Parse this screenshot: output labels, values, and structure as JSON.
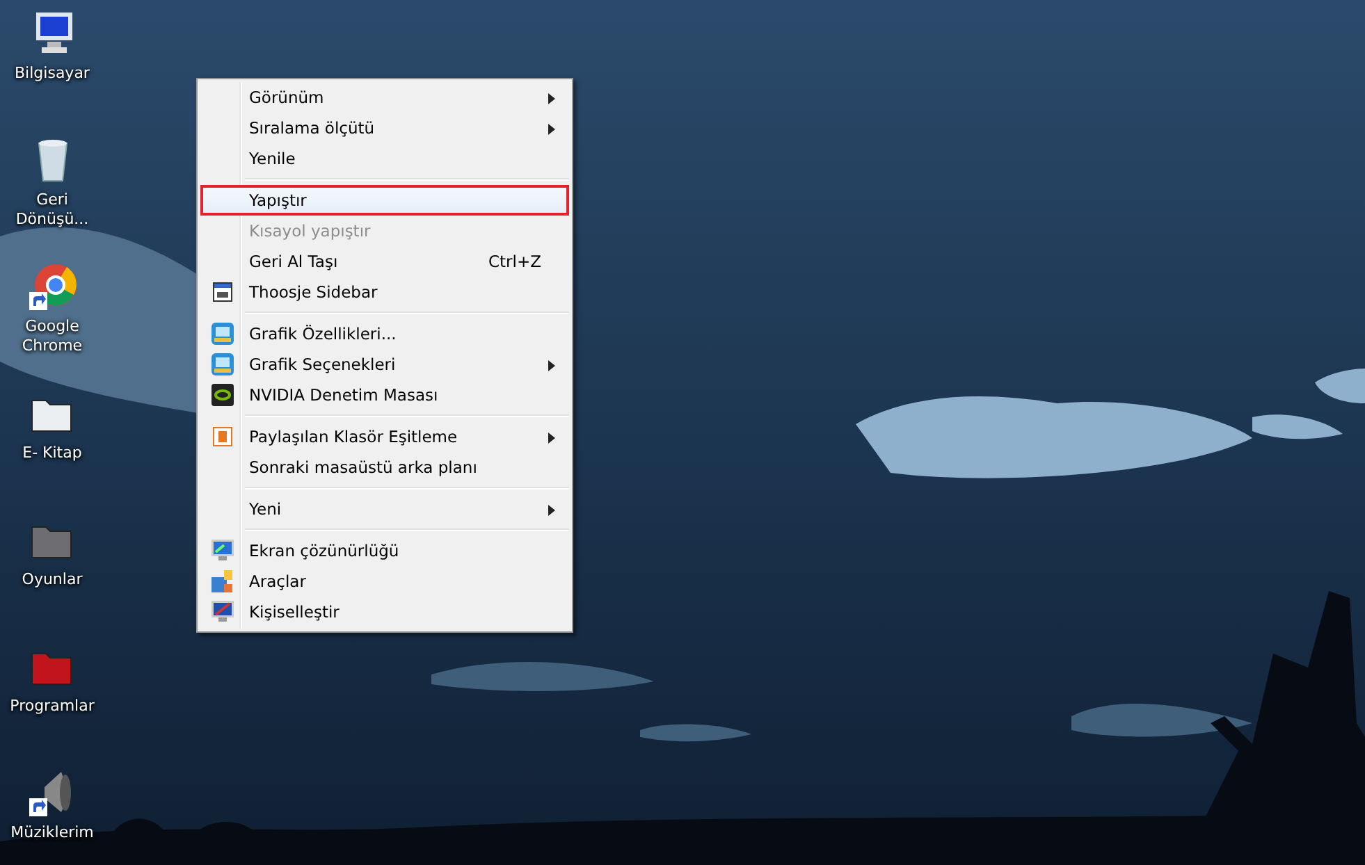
{
  "desktop_icons": [
    {
      "label": "Bilgisayar",
      "kind": "computer",
      "shortcut": false
    },
    {
      "label": "Geri Dönüşü...",
      "kind": "recycle",
      "shortcut": false
    },
    {
      "label": "Google Chrome",
      "kind": "browser",
      "shortcut": true
    },
    {
      "label": "E- Kitap",
      "kind": "folder-white",
      "shortcut": false
    },
    {
      "label": "Oyunlar",
      "kind": "folder-grey",
      "shortcut": false
    },
    {
      "label": "Programlar",
      "kind": "folder-red",
      "shortcut": false
    },
    {
      "label": "Müziklerim",
      "kind": "speaker",
      "shortcut": true
    }
  ],
  "context_menu": {
    "items": [
      {
        "kind": "item",
        "label": "Görünüm",
        "submenu": true,
        "disabled": false,
        "selected": false
      },
      {
        "kind": "item",
        "label": "Sıralama ölçütü",
        "submenu": true,
        "disabled": false,
        "selected": false
      },
      {
        "kind": "item",
        "label": "Yenile",
        "submenu": false,
        "disabled": false,
        "selected": false
      },
      {
        "kind": "separator"
      },
      {
        "kind": "item",
        "label": "Yapıştır",
        "submenu": false,
        "disabled": false,
        "selected": true
      },
      {
        "kind": "item",
        "label": "Kısayol yapıştır",
        "submenu": false,
        "disabled": true,
        "selected": false
      },
      {
        "kind": "item",
        "label": "Geri Al Taşı",
        "shortcut": "Ctrl+Z",
        "submenu": false,
        "disabled": false,
        "selected": false
      },
      {
        "kind": "item",
        "label": "Thoosje Sidebar",
        "submenu": false,
        "disabled": false,
        "selected": false
      },
      {
        "kind": "separator"
      },
      {
        "kind": "item",
        "label": "Grafik Özellikleri...",
        "submenu": false,
        "disabled": false,
        "selected": false
      },
      {
        "kind": "item",
        "label": "Grafik Seçenekleri",
        "submenu": true,
        "disabled": false,
        "selected": false
      },
      {
        "kind": "item",
        "label": "NVIDIA Denetim Masası",
        "submenu": false,
        "disabled": false,
        "selected": false
      },
      {
        "kind": "separator"
      },
      {
        "kind": "item",
        "label": "Paylaşılan Klasör Eşitleme",
        "submenu": true,
        "disabled": false,
        "selected": false
      },
      {
        "kind": "item",
        "label": "Sonraki masaüstü arka planı",
        "submenu": false,
        "disabled": false,
        "selected": false
      },
      {
        "kind": "separator"
      },
      {
        "kind": "item",
        "label": "Yeni",
        "submenu": true,
        "disabled": false,
        "selected": false
      },
      {
        "kind": "separator"
      },
      {
        "kind": "item",
        "label": "Ekran çözünürlüğü",
        "submenu": false,
        "disabled": false,
        "selected": false
      },
      {
        "kind": "item",
        "label": "Araçlar",
        "submenu": false,
        "disabled": false,
        "selected": false
      },
      {
        "kind": "item",
        "label": "Kişiselleştir",
        "submenu": false,
        "disabled": false,
        "selected": false
      }
    ]
  }
}
